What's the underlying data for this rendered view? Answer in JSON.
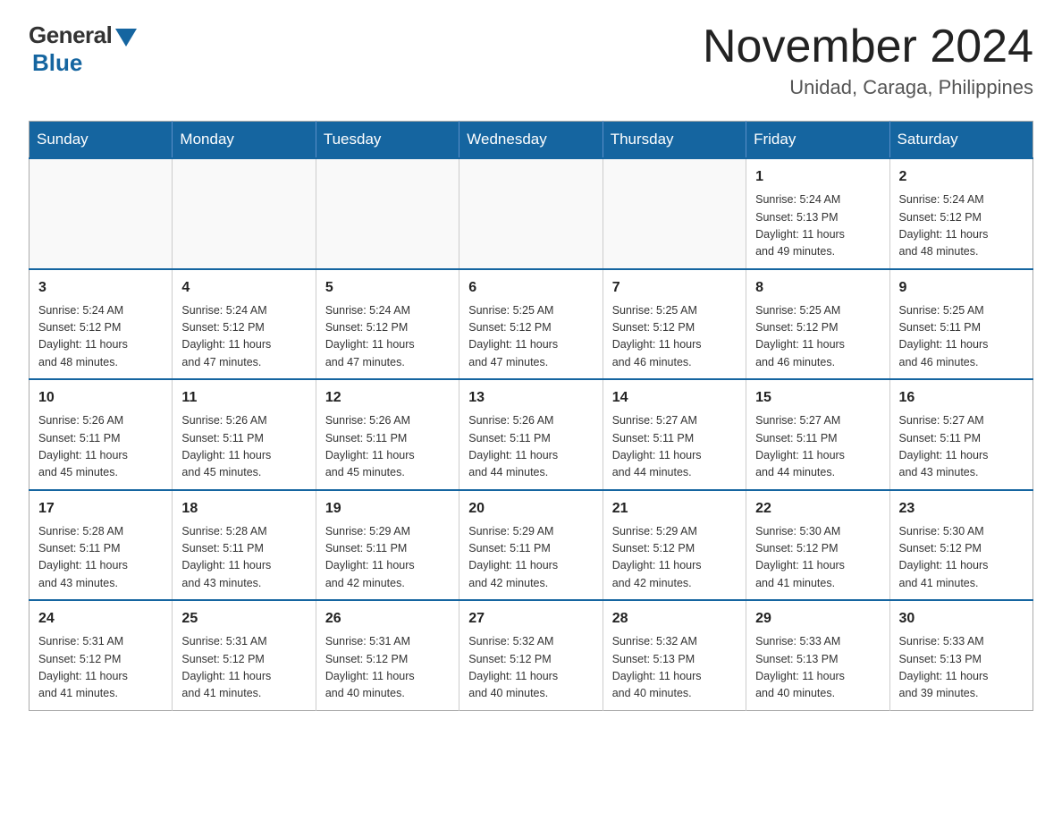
{
  "logo": {
    "general": "General",
    "blue": "Blue"
  },
  "header": {
    "title": "November 2024",
    "subtitle": "Unidad, Caraga, Philippines"
  },
  "days_of_week": [
    "Sunday",
    "Monday",
    "Tuesday",
    "Wednesday",
    "Thursday",
    "Friday",
    "Saturday"
  ],
  "weeks": [
    {
      "days": [
        {
          "num": "",
          "info": ""
        },
        {
          "num": "",
          "info": ""
        },
        {
          "num": "",
          "info": ""
        },
        {
          "num": "",
          "info": ""
        },
        {
          "num": "",
          "info": ""
        },
        {
          "num": "1",
          "info": "Sunrise: 5:24 AM\nSunset: 5:13 PM\nDaylight: 11 hours\nand 49 minutes."
        },
        {
          "num": "2",
          "info": "Sunrise: 5:24 AM\nSunset: 5:12 PM\nDaylight: 11 hours\nand 48 minutes."
        }
      ]
    },
    {
      "days": [
        {
          "num": "3",
          "info": "Sunrise: 5:24 AM\nSunset: 5:12 PM\nDaylight: 11 hours\nand 48 minutes."
        },
        {
          "num": "4",
          "info": "Sunrise: 5:24 AM\nSunset: 5:12 PM\nDaylight: 11 hours\nand 47 minutes."
        },
        {
          "num": "5",
          "info": "Sunrise: 5:24 AM\nSunset: 5:12 PM\nDaylight: 11 hours\nand 47 minutes."
        },
        {
          "num": "6",
          "info": "Sunrise: 5:25 AM\nSunset: 5:12 PM\nDaylight: 11 hours\nand 47 minutes."
        },
        {
          "num": "7",
          "info": "Sunrise: 5:25 AM\nSunset: 5:12 PM\nDaylight: 11 hours\nand 46 minutes."
        },
        {
          "num": "8",
          "info": "Sunrise: 5:25 AM\nSunset: 5:12 PM\nDaylight: 11 hours\nand 46 minutes."
        },
        {
          "num": "9",
          "info": "Sunrise: 5:25 AM\nSunset: 5:11 PM\nDaylight: 11 hours\nand 46 minutes."
        }
      ]
    },
    {
      "days": [
        {
          "num": "10",
          "info": "Sunrise: 5:26 AM\nSunset: 5:11 PM\nDaylight: 11 hours\nand 45 minutes."
        },
        {
          "num": "11",
          "info": "Sunrise: 5:26 AM\nSunset: 5:11 PM\nDaylight: 11 hours\nand 45 minutes."
        },
        {
          "num": "12",
          "info": "Sunrise: 5:26 AM\nSunset: 5:11 PM\nDaylight: 11 hours\nand 45 minutes."
        },
        {
          "num": "13",
          "info": "Sunrise: 5:26 AM\nSunset: 5:11 PM\nDaylight: 11 hours\nand 44 minutes."
        },
        {
          "num": "14",
          "info": "Sunrise: 5:27 AM\nSunset: 5:11 PM\nDaylight: 11 hours\nand 44 minutes."
        },
        {
          "num": "15",
          "info": "Sunrise: 5:27 AM\nSunset: 5:11 PM\nDaylight: 11 hours\nand 44 minutes."
        },
        {
          "num": "16",
          "info": "Sunrise: 5:27 AM\nSunset: 5:11 PM\nDaylight: 11 hours\nand 43 minutes."
        }
      ]
    },
    {
      "days": [
        {
          "num": "17",
          "info": "Sunrise: 5:28 AM\nSunset: 5:11 PM\nDaylight: 11 hours\nand 43 minutes."
        },
        {
          "num": "18",
          "info": "Sunrise: 5:28 AM\nSunset: 5:11 PM\nDaylight: 11 hours\nand 43 minutes."
        },
        {
          "num": "19",
          "info": "Sunrise: 5:29 AM\nSunset: 5:11 PM\nDaylight: 11 hours\nand 42 minutes."
        },
        {
          "num": "20",
          "info": "Sunrise: 5:29 AM\nSunset: 5:11 PM\nDaylight: 11 hours\nand 42 minutes."
        },
        {
          "num": "21",
          "info": "Sunrise: 5:29 AM\nSunset: 5:12 PM\nDaylight: 11 hours\nand 42 minutes."
        },
        {
          "num": "22",
          "info": "Sunrise: 5:30 AM\nSunset: 5:12 PM\nDaylight: 11 hours\nand 41 minutes."
        },
        {
          "num": "23",
          "info": "Sunrise: 5:30 AM\nSunset: 5:12 PM\nDaylight: 11 hours\nand 41 minutes."
        }
      ]
    },
    {
      "days": [
        {
          "num": "24",
          "info": "Sunrise: 5:31 AM\nSunset: 5:12 PM\nDaylight: 11 hours\nand 41 minutes."
        },
        {
          "num": "25",
          "info": "Sunrise: 5:31 AM\nSunset: 5:12 PM\nDaylight: 11 hours\nand 41 minutes."
        },
        {
          "num": "26",
          "info": "Sunrise: 5:31 AM\nSunset: 5:12 PM\nDaylight: 11 hours\nand 40 minutes."
        },
        {
          "num": "27",
          "info": "Sunrise: 5:32 AM\nSunset: 5:12 PM\nDaylight: 11 hours\nand 40 minutes."
        },
        {
          "num": "28",
          "info": "Sunrise: 5:32 AM\nSunset: 5:13 PM\nDaylight: 11 hours\nand 40 minutes."
        },
        {
          "num": "29",
          "info": "Sunrise: 5:33 AM\nSunset: 5:13 PM\nDaylight: 11 hours\nand 40 minutes."
        },
        {
          "num": "30",
          "info": "Sunrise: 5:33 AM\nSunset: 5:13 PM\nDaylight: 11 hours\nand 39 minutes."
        }
      ]
    }
  ]
}
